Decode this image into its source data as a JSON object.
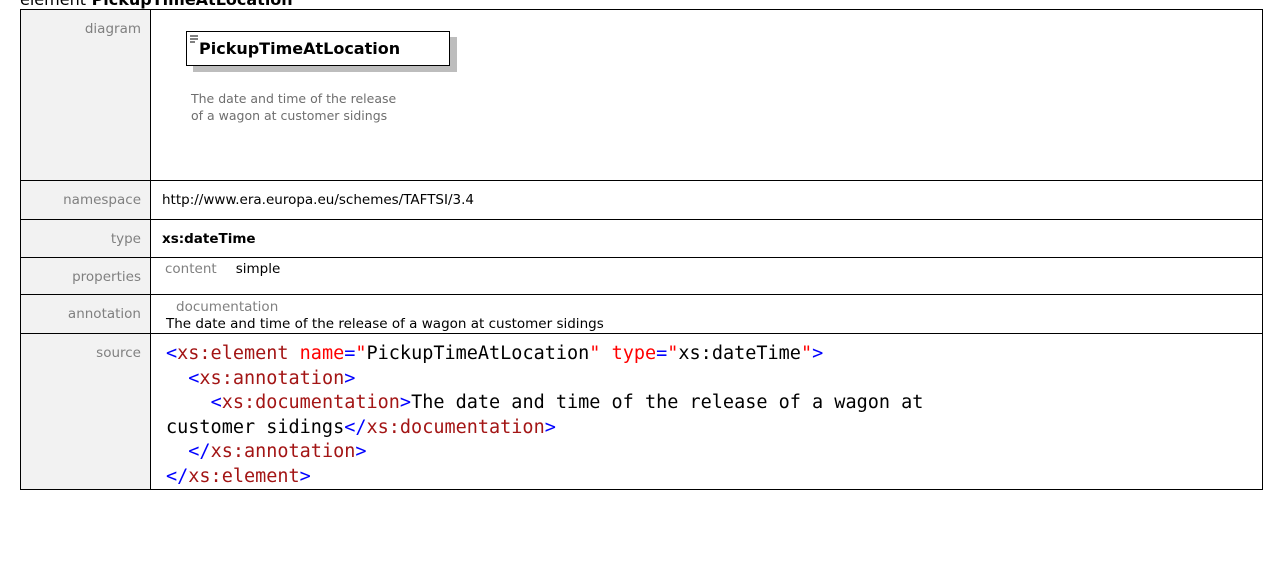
{
  "title": {
    "prefix": "element",
    "name": "PickupTimeAtLocation"
  },
  "rows": {
    "diagram": {
      "label": "diagram",
      "element_name": "PickupTimeAtLocation",
      "documentation": "The date and time of the release of a wagon at customer sidings"
    },
    "namespace": {
      "label": "namespace",
      "value": "http://www.era.europa.eu/schemes/TAFTSI/3.4"
    },
    "type": {
      "label": "type",
      "value": "xs:dateTime"
    },
    "properties": {
      "label": "properties",
      "key": "content",
      "value": "simple"
    },
    "annotation": {
      "label": "annotation",
      "key": "documentation",
      "value": "The date and time of the release of a wagon at customer sidings"
    },
    "source": {
      "label": "source",
      "line1": {
        "open": "<",
        "tag": "xs:element",
        "attr1": "name",
        "eq1": "=",
        "q1a": "\"",
        "val1": "PickupTimeAtLocation",
        "q1b": "\"",
        "attr2": "type",
        "eq2": "=",
        "q2a": "\"",
        "val2": "xs:dateTime",
        "q2b": "\"",
        "close": ">"
      },
      "line2": {
        "open": "<",
        "tag": "xs:annotation",
        "close": ">"
      },
      "line3": {
        "open": "<",
        "tag": "xs:documentation",
        "close": ">",
        "text": "The date and time of the release of a wagon at"
      },
      "line4": {
        "text": "customer sidings",
        "open": "</",
        "tag": "xs:documentation",
        "close": ">"
      },
      "line5": {
        "open": "</",
        "tag": "xs:annotation",
        "close": ">"
      },
      "line6": {
        "open": "</",
        "tag": "xs:element",
        "close": ">"
      }
    }
  },
  "colors": {
    "label_text": "#808080",
    "xml_bracket": "#0000ff",
    "xml_tag": "#a31515",
    "xml_attribute": "#ff0000"
  },
  "icons": {
    "diagram_element": "documentation-lines-icon"
  }
}
